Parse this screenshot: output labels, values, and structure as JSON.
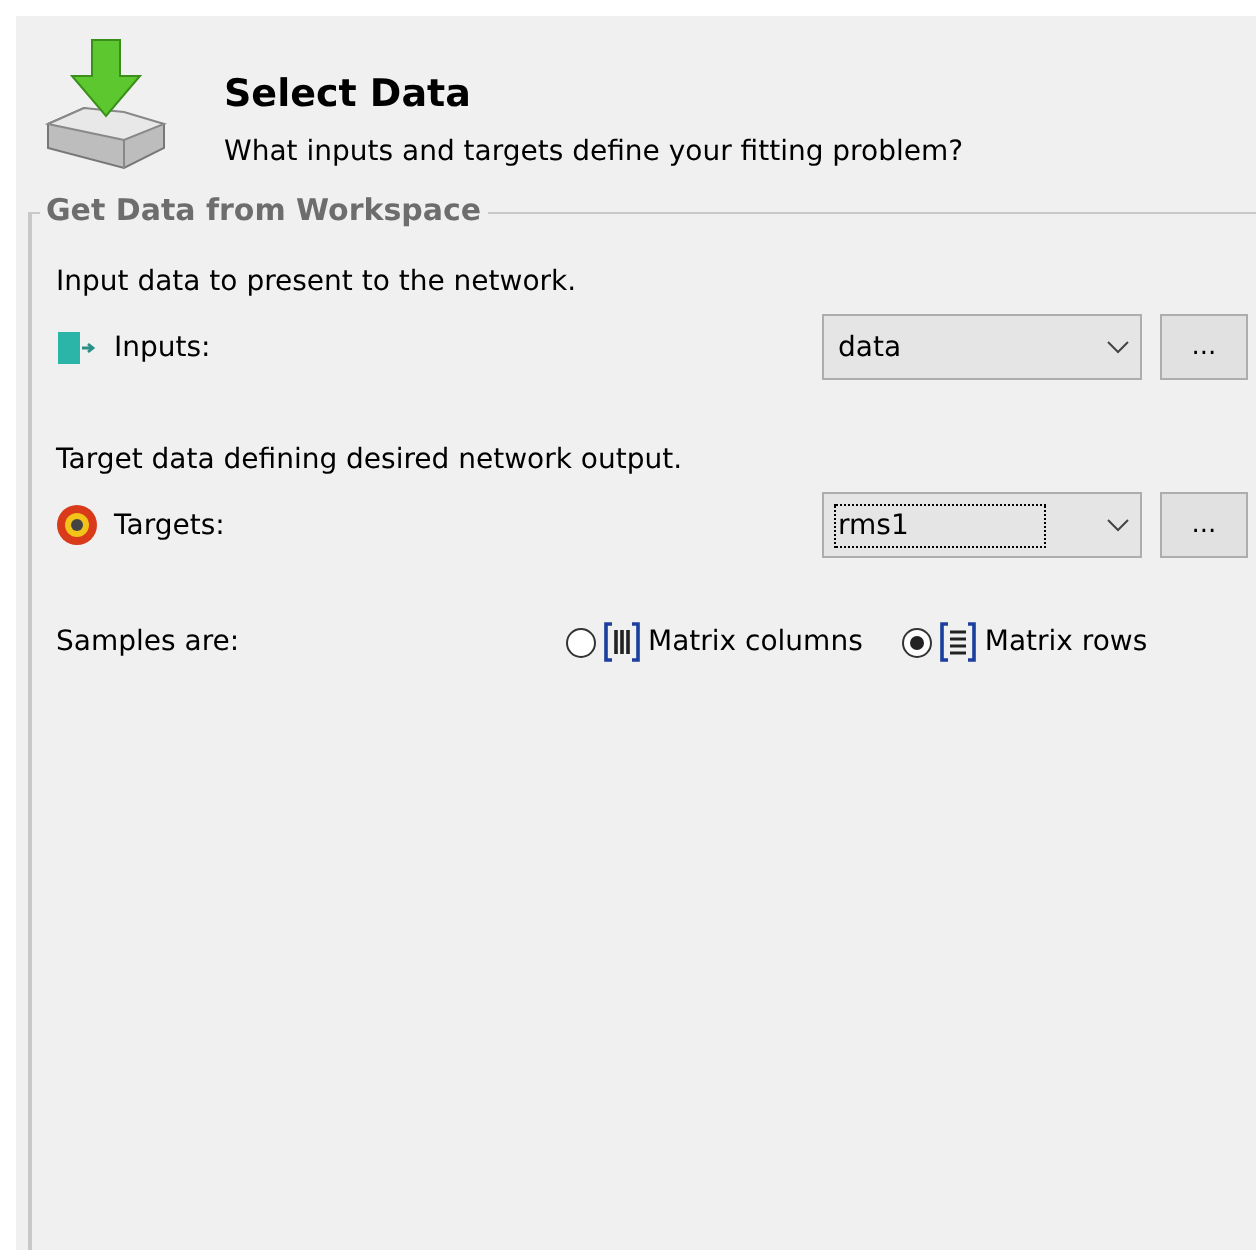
{
  "header": {
    "title": "Select Data",
    "subtitle": "What inputs and targets define your fitting problem?"
  },
  "group": {
    "legend": "Get Data from Workspace",
    "fields": [
      {
        "kind": "inputs",
        "description": "Input data to present to the network.",
        "label": "Inputs:",
        "value": "data",
        "focused": false,
        "browse": "..."
      },
      {
        "kind": "targets",
        "description": "Target data defining desired network output.",
        "label": "Targets:",
        "value": "rms1",
        "focused": true,
        "browse": "..."
      }
    ],
    "samples": {
      "label": "Samples are:",
      "options": [
        {
          "kind": "columns",
          "label": "Matrix columns",
          "selected": false
        },
        {
          "kind": "rows",
          "label": "Matrix rows",
          "selected": true
        }
      ]
    }
  }
}
